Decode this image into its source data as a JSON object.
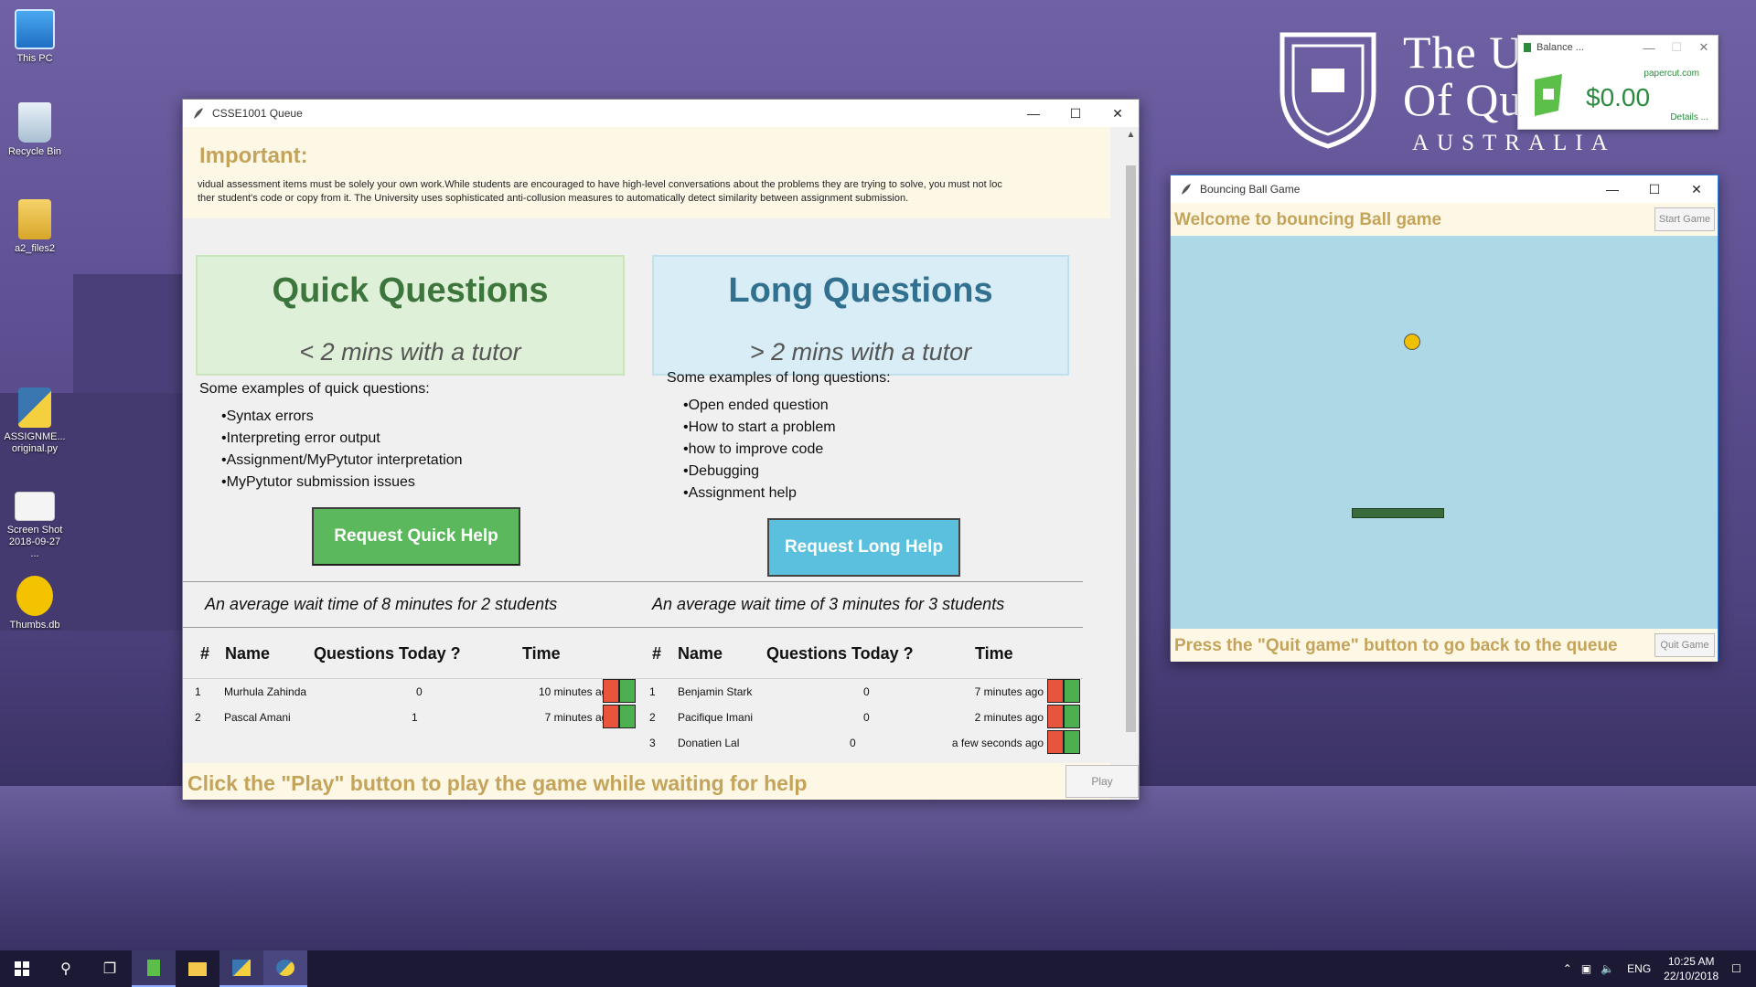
{
  "desktop": {
    "icons": [
      {
        "label": "This PC"
      },
      {
        "label": "Recycle Bin"
      },
      {
        "label": "a2_files2"
      },
      {
        "label": "ASSIGNME...",
        "label2": "original.py"
      },
      {
        "label": "Screen Shot",
        "label2": "2018-09-27 ..."
      },
      {
        "label": "Thumbs.db"
      }
    ],
    "logo": {
      "line1": "The University",
      "line2": "Of Queensland",
      "line3": "AUSTRALIA"
    }
  },
  "papercut": {
    "title": "Balance ...",
    "site": "papercut.com",
    "amount": "$0.00",
    "details": "Details ..."
  },
  "queue_window": {
    "title": "CSSE1001 Queue",
    "important": {
      "heading": "Important:",
      "line1": "vidual assessment items must be solely your own work.While students are encouraged to have high-level conversations about the problems they are trying to solve, you must not loc",
      "line2": "ther student's code or copy from it. The University uses sophisticated anti-collusion measures to automatically detect similarity between assignment submission."
    },
    "quick": {
      "title": "Quick Questions",
      "subtitle": "< 2 mins with a tutor",
      "examples_heading": "Some examples of quick questions:",
      "examples": [
        "Syntax errors",
        "Interpreting error output",
        "Assignment/MyPytutor interpretation",
        "MyPytutor submission issues"
      ],
      "button": "Request Quick Help",
      "wait_text": "An average wait time of 8 minutes for 2 students",
      "columns": [
        "#",
        "Name",
        "Questions Today ?",
        "Time"
      ],
      "rows": [
        {
          "num": "1",
          "name": "Murhula Zahinda",
          "questions": "0",
          "time": "10  minutes ago"
        },
        {
          "num": "2",
          "name": "Pascal Amani",
          "questions": "1",
          "time": "7  minutes ago"
        }
      ]
    },
    "long": {
      "title": "Long Questions",
      "subtitle": "> 2 mins with a tutor",
      "examples_heading": "Some examples of long questions:",
      "examples": [
        "Open ended question",
        "How to start a problem",
        "how to improve code",
        "Debugging",
        "Assignment help"
      ],
      "button": "Request Long Help",
      "wait_text": "An average wait time of 3 minutes for 3 students",
      "columns": [
        "#",
        "Name",
        "Questions Today ?",
        "Time"
      ],
      "rows": [
        {
          "num": "1",
          "name": "Benjamin Stark",
          "questions": "0",
          "time": "7  minutes ago"
        },
        {
          "num": "2",
          "name": "Pacifique Imani",
          "questions": "0",
          "time": "2  minutes ago"
        },
        {
          "num": "3",
          "name": "Donatien Lal",
          "questions": "0",
          "time": "a few seconds ago"
        }
      ]
    },
    "play_message": "Click the \"Play\" button to play the game while waiting for help",
    "play_button": "Play"
  },
  "game_window": {
    "title": "Bouncing Ball Game",
    "welcome": "Welcome to bouncing Ball game",
    "start_button": "Start Game",
    "quit_message": "Press the \"Quit game\" button to go back to the queue",
    "quit_button": "Quit Game"
  },
  "taskbar": {
    "language": "ENG",
    "time": "10:25 AM",
    "date": "22/10/2018"
  },
  "colors": {
    "accent_gold": "#c4a35a",
    "quick_green": "#5cb85c",
    "long_blue": "#5bc0de",
    "game_bg": "#add8e6"
  }
}
